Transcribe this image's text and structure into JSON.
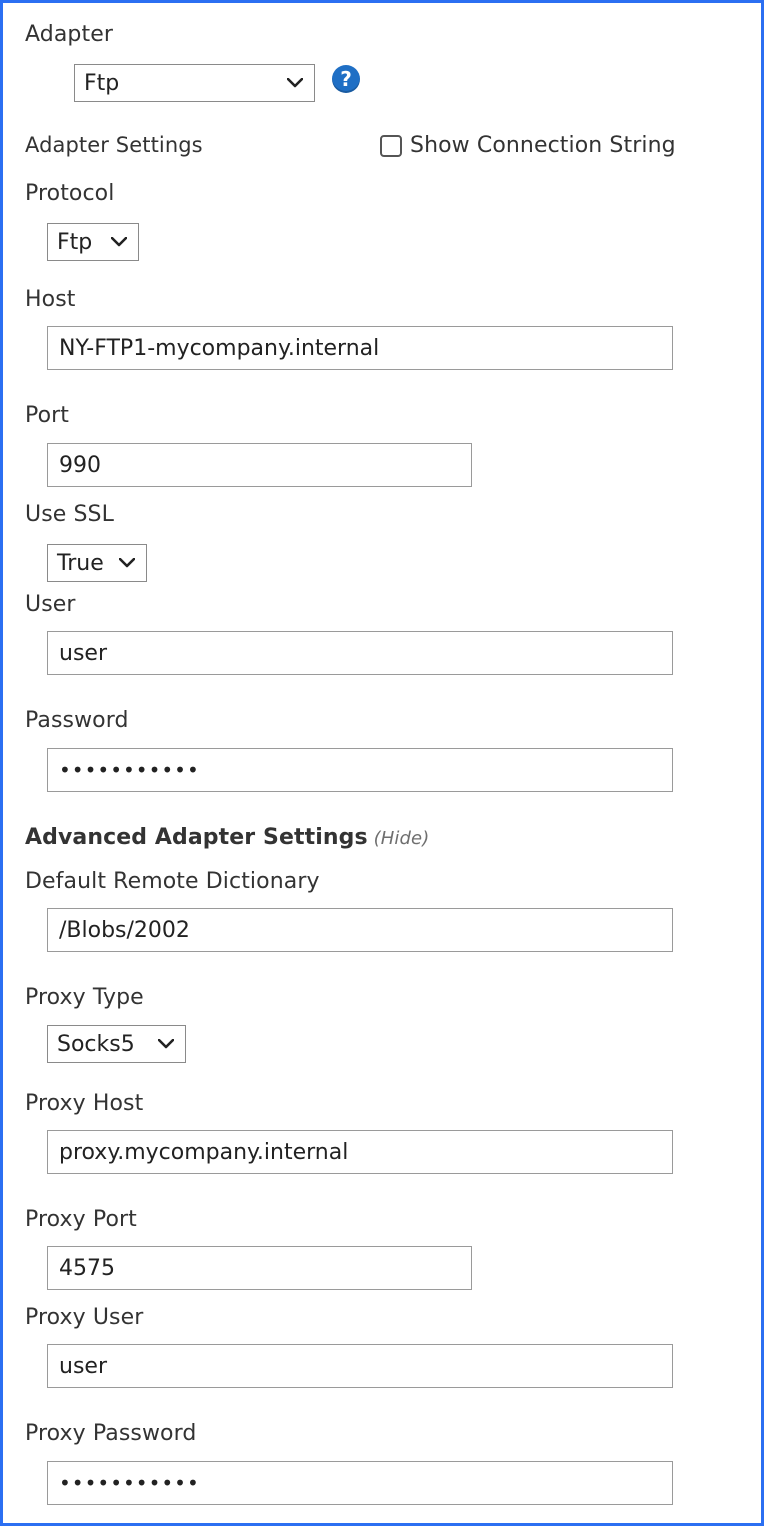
{
  "adapter": {
    "label": "Adapter",
    "selected": "Ftp",
    "help_icon": "question-icon",
    "help_glyph": "?"
  },
  "adapter_settings": {
    "label": "Adapter Settings",
    "show_connection_string": {
      "label": "Show Connection String",
      "checked": false
    }
  },
  "fields": {
    "protocol": {
      "label": "Protocol",
      "value": "Ftp"
    },
    "host": {
      "label": "Host",
      "value": "NY-FTP1-mycompany.internal"
    },
    "port": {
      "label": "Port",
      "value": "990"
    },
    "use_ssl": {
      "label": "Use SSL",
      "value": "True"
    },
    "user": {
      "label": "User",
      "value": "user"
    },
    "password": {
      "label": "Password",
      "value": "•••••••••••"
    }
  },
  "advanced": {
    "title": "Advanced Adapter Settings",
    "toggle": "(Hide)",
    "default_remote_dictionary": {
      "label": "Default Remote Dictionary",
      "value": "/Blobs/2002"
    },
    "proxy_type": {
      "label": "Proxy Type",
      "value": "Socks5"
    },
    "proxy_host": {
      "label": "Proxy Host",
      "value": "proxy.mycompany.internal"
    },
    "proxy_port": {
      "label": "Proxy Port",
      "value": "4575"
    },
    "proxy_user": {
      "label": "Proxy User",
      "value": "user"
    },
    "proxy_password": {
      "label": "Proxy Password",
      "value": "•••••••••••"
    }
  },
  "colors": {
    "frame_border": "#2b6ff2",
    "help_icon": "#1f6fc5",
    "text": "#333333"
  }
}
